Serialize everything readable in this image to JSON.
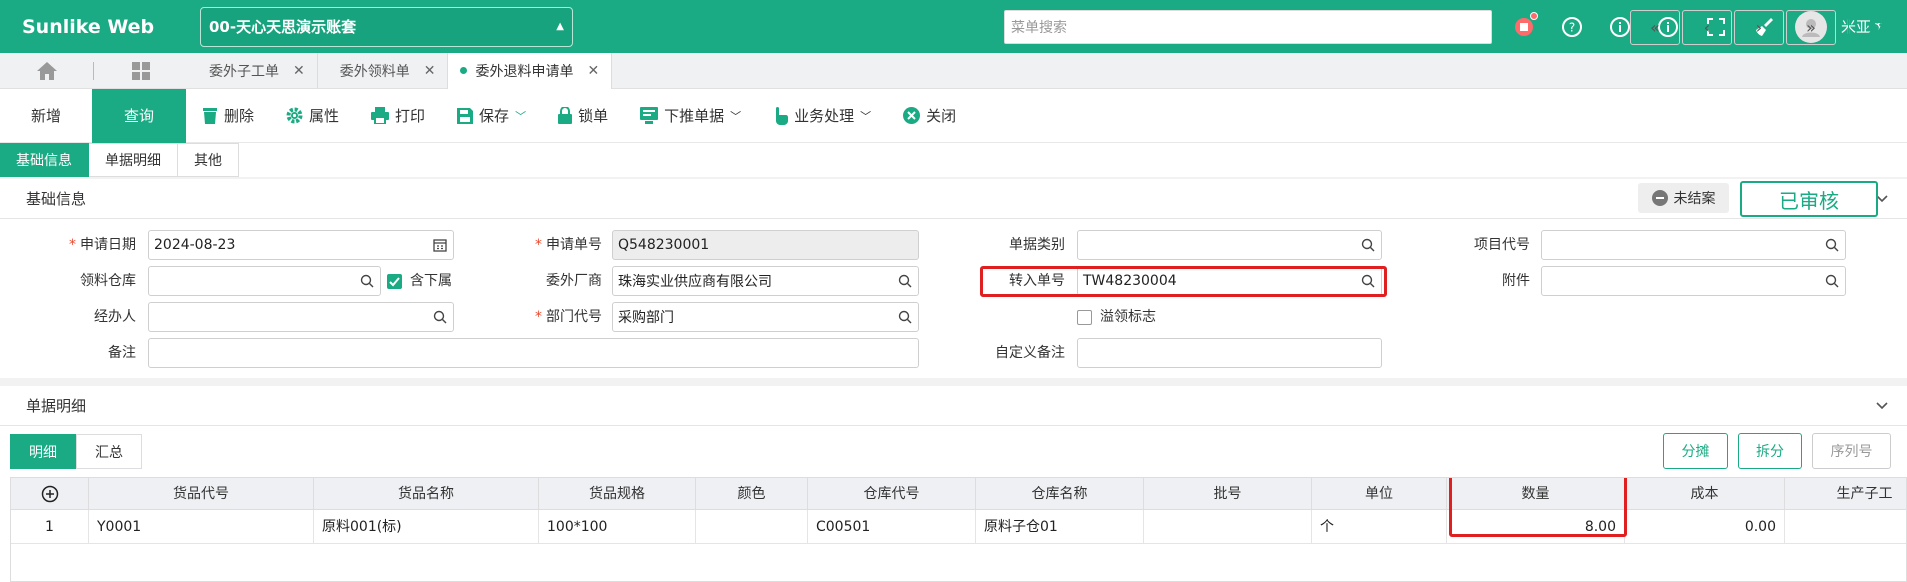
{
  "app": {
    "brand": "Sunlike Web",
    "account": "00-天心天思演示账套",
    "search_placeholder": "菜单搜索",
    "user": "米亚"
  },
  "tabs": [
    {
      "label": "委外子工单"
    },
    {
      "label": "委外领料单"
    },
    {
      "label": "委外退料申请单",
      "active": true
    }
  ],
  "toolbar": {
    "new": "新增",
    "query": "查询",
    "delete": "删除",
    "properties": "属性",
    "print": "打印",
    "save": "保存",
    "lock": "锁单",
    "push_down": "下推单据",
    "business": "业务处理",
    "close": "关闭"
  },
  "nav_icons": [
    "first-icon",
    "prev-icon",
    "next-icon",
    "last-icon"
  ],
  "section_tabs": [
    "基础信息",
    "单据明细",
    "其他"
  ],
  "basic": {
    "title": "基础信息",
    "status_tag": "未结案",
    "approved": "已审核",
    "fields": {
      "apply_date_label": "申请日期",
      "apply_date": "2024-08-23",
      "apply_no_label": "申请单号",
      "apply_no": "Q548230001",
      "doc_type_label": "单据类别",
      "doc_type": "",
      "project_label": "项目代号",
      "project": "",
      "warehouse_label": "领料仓库",
      "warehouse": "",
      "include_sub_label": "含下属",
      "include_sub": true,
      "vendor_label": "委外厂商",
      "vendor": "珠海实业供应商有限公司",
      "transfer_no_label": "转入单号",
      "transfer_no": "TW48230004",
      "attachment_label": "附件",
      "attachment": "",
      "handler_label": "经办人",
      "handler": "",
      "dept_label": "部门代号",
      "dept": "采购部门",
      "overflow_label": "溢领标志",
      "overflow": false,
      "remark_label": "备注",
      "remark": "",
      "custom_remark_label": "自定义备注",
      "custom_remark": ""
    }
  },
  "detail": {
    "title": "单据明细",
    "tabs": [
      "明细",
      "汇总"
    ],
    "buttons": {
      "allocate": "分摊",
      "split": "拆分",
      "serial": "序列号"
    },
    "columns": [
      "货品代号",
      "货品名称",
      "货品规格",
      "颜色",
      "仓库代号",
      "仓库名称",
      "批号",
      "单位",
      "数量",
      "成本",
      "生产子工"
    ],
    "rows": [
      {
        "idx": "1",
        "code": "Y0001",
        "name": "原料001(标)",
        "spec": "100*100",
        "color": "",
        "wh_code": "C00501",
        "wh_name": "原料子仓01",
        "batch": "",
        "unit": "个",
        "qty": "8.00",
        "cost": "0.00",
        "sub": ""
      }
    ]
  },
  "colors": {
    "primary": "#1aaa84",
    "highlight": "#e02020"
  }
}
